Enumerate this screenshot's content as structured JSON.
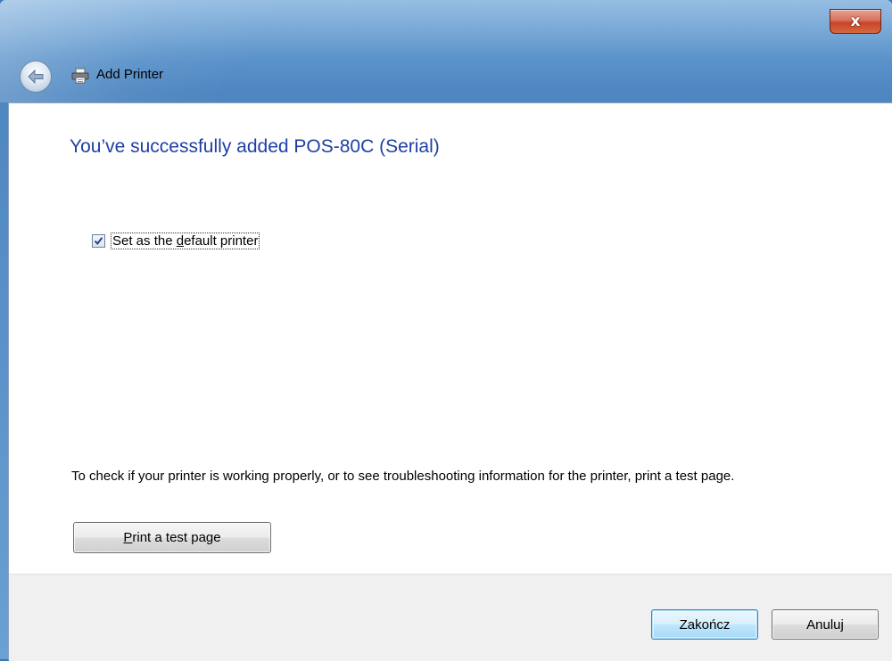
{
  "window": {
    "title": "Add Printer",
    "close_label": "x"
  },
  "content": {
    "heading": "You’ve successfully added POS-80C (Serial)",
    "default_checkbox": {
      "checked": true,
      "label_pre": "Set as the ",
      "label_accel": "d",
      "label_post": "efault printer"
    },
    "info_text": "To check if your printer is working properly, or to see troubleshooting information for the printer, print a test page.",
    "test_button": {
      "accel": "P",
      "rest": "rint a test page"
    }
  },
  "footer": {
    "finish_label": "Zakończ",
    "cancel_label": "Anuluj"
  },
  "icons": {
    "back": "back-arrow-icon",
    "printer": "printer-icon",
    "check": "checkmark-icon"
  },
  "colors": {
    "heading": "#1e3fa5",
    "frame": "#5d95cc",
    "close": "#c7462a"
  }
}
